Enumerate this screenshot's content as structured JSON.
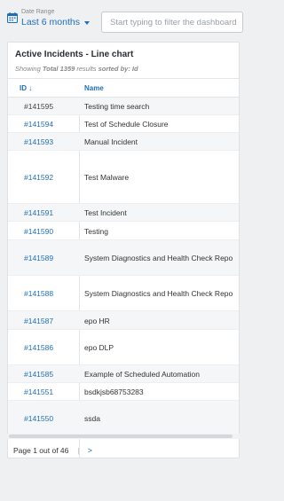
{
  "header": {
    "range_label": "Date Range",
    "range_value": "Last 6 months",
    "filter_placeholder": "Start typing to filter the dashboard"
  },
  "panel": {
    "title": "Active Incidents - Line chart",
    "summary_prefix": "Showing",
    "summary_total": "Total 1359",
    "summary_mid": "results",
    "summary_sort": "sorted by: Id",
    "columns": {
      "id": "ID",
      "name": "Name"
    }
  },
  "rows": [
    {
      "id": "#141595",
      "name": "Testing time search"
    },
    {
      "id": "#141594",
      "name": "Test of Schedule Closure"
    },
    {
      "id": "#141593",
      "name": "Manual Incident"
    },
    {
      "id": "#141592",
      "name": "Test Malware"
    },
    {
      "id": "#141591",
      "name": "Test Incident"
    },
    {
      "id": "#141590",
      "name": "Testing"
    },
    {
      "id": "#141589",
      "name": "System Diagnostics and Health Check Repo"
    },
    {
      "id": "#141588",
      "name": "System Diagnostics and Health Check Repo"
    },
    {
      "id": "#141587",
      "name": "epo HR"
    },
    {
      "id": "#141586",
      "name": "epo DLP"
    },
    {
      "id": "#141585",
      "name": "Example of Scheduled Automation"
    },
    {
      "id": "#141551",
      "name": "bsdkjsb68753283"
    },
    {
      "id": "#141550",
      "name": "ssda"
    }
  ],
  "pager": {
    "text": "Page 1 out of 46",
    "separator": "|",
    "next": ">"
  },
  "colors": {
    "accent": "#1f6fb8",
    "alt_row": "#f5f6f7",
    "background": "#eef0f2"
  }
}
